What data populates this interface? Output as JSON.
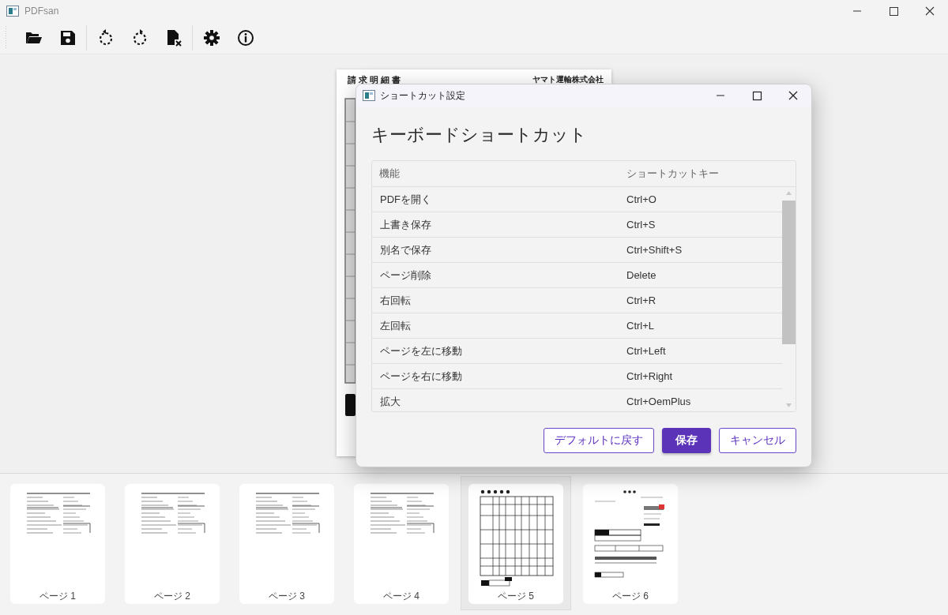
{
  "window": {
    "title": "PDFsan"
  },
  "document_preview": {
    "title": "請 求 明 細 書",
    "company": "ヤマト運輸株式会社"
  },
  "dialog": {
    "title": "ショートカット設定",
    "heading": "キーボードショートカット",
    "table": {
      "columns": [
        "機能",
        "ショートカットキー"
      ],
      "rows": [
        {
          "function": "PDFを開く",
          "key": "Ctrl+O"
        },
        {
          "function": "上書き保存",
          "key": "Ctrl+S"
        },
        {
          "function": "別名で保存",
          "key": "Ctrl+Shift+S"
        },
        {
          "function": "ページ削除",
          "key": "Delete"
        },
        {
          "function": "右回転",
          "key": "Ctrl+R"
        },
        {
          "function": "左回転",
          "key": "Ctrl+L"
        },
        {
          "function": "ページを左に移動",
          "key": "Ctrl+Left"
        },
        {
          "function": "ページを右に移動",
          "key": "Ctrl+Right"
        },
        {
          "function": "拡大",
          "key": "Ctrl+OemPlus"
        }
      ]
    },
    "buttons": [
      {
        "label": "デフォルトに戻す",
        "kind": "outline"
      },
      {
        "label": "保存",
        "kind": "primary"
      },
      {
        "label": "キャンセル",
        "kind": "outline"
      }
    ]
  },
  "thumbnails": [
    {
      "label": "ページ 1",
      "kind": "form",
      "selected": false
    },
    {
      "label": "ページ 2",
      "kind": "form",
      "selected": false
    },
    {
      "label": "ページ 3",
      "kind": "form",
      "selected": false
    },
    {
      "label": "ページ 4",
      "kind": "form",
      "selected": false
    },
    {
      "label": "ページ 5",
      "kind": "grid",
      "selected": true
    },
    {
      "label": "ページ 6",
      "kind": "invoice",
      "selected": false
    }
  ]
}
